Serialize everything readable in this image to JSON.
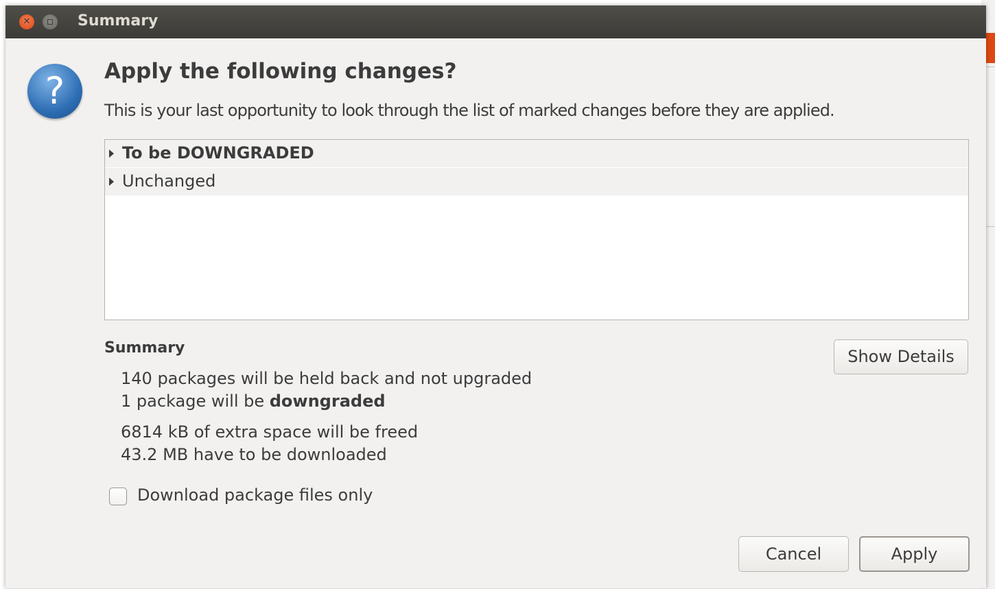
{
  "window": {
    "title": "Summary",
    "close_glyph": "✕"
  },
  "icon": {
    "name": "question-icon",
    "glyph": "?"
  },
  "heading": "Apply the following changes?",
  "description": "This is your last opportunity to look through the list of marked changes before they are applied.",
  "changes_tree": {
    "groups": [
      {
        "label": "To be DOWNGRADED",
        "expanded": false
      },
      {
        "label": "Unchanged",
        "expanded": false
      }
    ]
  },
  "summary": {
    "title": "Summary",
    "held_back": "140 packages will be held back and not upgraded",
    "downgraded_prefix": "1 package will be ",
    "downgraded_word": "downgraded",
    "space_freed": "6814 kB of extra space will be freed",
    "download_size": "43.2 MB have to be downloaded"
  },
  "buttons": {
    "show_details": "Show Details",
    "cancel": "Cancel",
    "apply": "Apply"
  },
  "download_only": {
    "label": "Download package files only",
    "checked": false
  },
  "colors": {
    "accent_orange": "#dd4814",
    "titlebar": "#3c3b37",
    "dialog_bg": "#f2f1f0",
    "icon_blue": "#2f6fb5"
  }
}
